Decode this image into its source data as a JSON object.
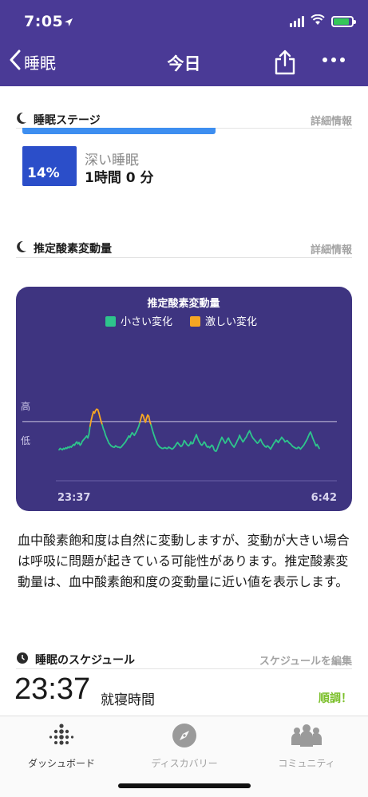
{
  "status": {
    "time": "7:05"
  },
  "nav": {
    "back_label": "睡眠",
    "title": "今日"
  },
  "sleep_stages": {
    "title": "睡眠ステージ",
    "detail_link": "詳細情報",
    "deep": {
      "label": "深い睡眠",
      "percent": "14%",
      "duration": "1時間 0 分"
    }
  },
  "spo2": {
    "title": "推定酸素変動量",
    "detail_link": "詳細情報",
    "description": "血中酸素飽和度は自然に変動しますが、変動が大きい場合は呼吸に問題が起きている可能性があります。推定酸素変動量は、血中酸素飽和度の変動量に近い値を表示します。"
  },
  "chart_data": {
    "type": "line",
    "title": "推定酸素変動量",
    "y_labels": [
      "高",
      "低"
    ],
    "x_tick_labels": [
      "23:37",
      "6:42"
    ],
    "legend_position": "top-center",
    "series": [
      {
        "name": "小さい変化",
        "color": "#2ec48c"
      },
      {
        "name": "激しい変化",
        "color": "#f6a623"
      }
    ],
    "threshold_color": "#c9c4e0",
    "values": [
      12,
      14,
      13,
      12,
      14,
      13,
      15,
      14,
      16,
      15,
      17,
      16,
      18,
      20,
      19,
      22,
      24,
      21,
      23,
      19,
      21,
      25,
      27,
      29,
      31,
      33,
      30,
      36,
      48,
      57,
      64,
      70,
      68,
      72,
      74,
      73,
      68,
      61,
      55,
      50,
      44,
      40,
      34,
      30,
      26,
      22,
      20,
      18,
      17,
      16,
      16,
      18,
      17,
      16,
      16,
      15,
      16,
      18,
      20,
      22,
      24,
      27,
      30,
      33,
      31,
      35,
      38,
      36,
      34,
      37,
      40,
      44,
      48,
      54,
      60,
      66,
      64,
      58,
      54,
      60,
      65,
      63,
      55,
      50,
      44,
      38,
      33,
      28,
      24,
      20,
      18,
      16,
      15,
      14,
      14,
      15,
      15,
      14,
      14,
      16,
      15,
      14,
      13,
      14,
      16,
      18,
      21,
      23,
      21,
      19,
      17,
      18,
      21,
      26,
      24,
      21,
      19,
      18,
      20,
      24,
      21,
      22,
      27,
      31,
      35,
      30,
      26,
      23,
      20,
      19,
      21,
      24,
      22,
      18,
      16,
      17,
      15,
      17,
      19,
      17,
      12,
      10,
      10,
      14,
      19,
      23,
      27,
      31,
      28,
      25,
      22,
      24,
      28,
      30,
      26,
      23,
      20,
      18,
      16,
      19,
      22,
      26,
      29,
      34,
      30,
      27,
      24,
      26,
      29,
      31,
      35,
      38,
      41,
      37,
      33,
      30,
      28,
      26,
      24,
      22,
      23,
      26,
      28,
      24,
      21,
      19,
      17,
      16,
      18,
      17,
      15,
      13,
      16,
      19,
      22,
      24,
      27,
      25,
      23,
      26,
      28,
      31,
      29,
      27,
      24,
      25,
      26,
      24,
      22,
      21,
      19,
      17,
      16,
      15,
      14,
      14,
      16,
      15,
      13,
      15,
      17,
      19,
      22,
      25,
      28,
      32,
      36,
      39,
      35,
      30,
      26,
      22,
      18,
      20,
      17,
      14
    ],
    "high_threshold_value": 55
  },
  "schedule": {
    "title": "睡眠のスケジュール",
    "edit_link": "スケジュールを編集",
    "bedtime": "23:37",
    "bedtime_label": "就寝時間",
    "status": "順調！"
  },
  "tabs": [
    {
      "label": "ダッシュボード",
      "icon": "dashboard-dots-icon",
      "active": true
    },
    {
      "label": "ディスカバリー",
      "icon": "compass-icon",
      "active": false
    },
    {
      "label": "コミュニティ",
      "icon": "community-icon",
      "active": false
    }
  ]
}
